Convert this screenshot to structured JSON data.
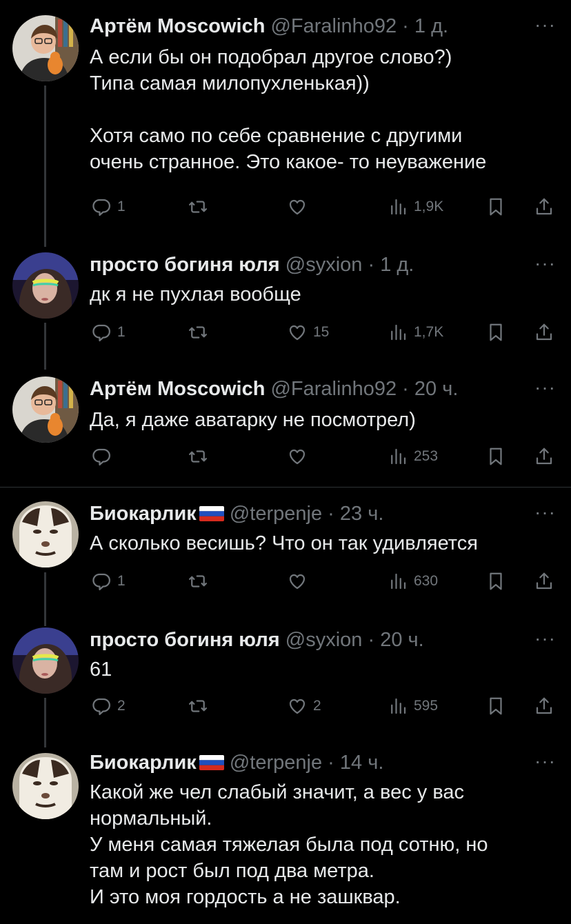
{
  "tweets": [
    {
      "name": "Артём Moscowich",
      "flag": false,
      "handle": "@Faralinho92",
      "dot": "·",
      "time": "1 д.",
      "more": "···",
      "text": "А если бы он подобрал другое слово?)\nТипа самая милопухленькая))\n\nХотя само по себе сравнение с другими\nочень странное. Это какое- то неуважение",
      "replies": "1",
      "retweets": "",
      "likes": "",
      "views": "1,9K",
      "avatar": "man"
    },
    {
      "name": "просто богиня юля",
      "flag": false,
      "handle": "@syxion",
      "dot": "·",
      "time": "1 д.",
      "more": "···",
      "text": "дк я не пухлая вообще",
      "replies": "1",
      "retweets": "",
      "likes": "15",
      "views": "1,7K",
      "avatar": "girl"
    },
    {
      "name": "Артём Moscowich",
      "flag": false,
      "handle": "@Faralinho92",
      "dot": "·",
      "time": "20 ч.",
      "more": "···",
      "text": "Да, я даже аватарку не посмотрел)",
      "replies": "",
      "retweets": "",
      "likes": "",
      "views": "253",
      "avatar": "man"
    },
    {
      "name": "Биокарлик",
      "flag": true,
      "handle": "@terpenje",
      "dot": "·",
      "time": "23 ч.",
      "more": "···",
      "text": "А сколько весишь? Что он так удивляется",
      "replies": "1",
      "retweets": "",
      "likes": "",
      "views": "630",
      "avatar": "cat"
    },
    {
      "name": "просто богиня юля",
      "flag": false,
      "handle": "@syxion",
      "dot": "·",
      "time": "20 ч.",
      "more": "···",
      "text": "61",
      "replies": "2",
      "retweets": "",
      "likes": "2",
      "views": "595",
      "avatar": "girl"
    },
    {
      "name": "Биокарлик",
      "flag": true,
      "handle": "@terpenje",
      "dot": "·",
      "time": "14 ч.",
      "more": "···",
      "text": "Какой же чел слабый значит, а вес у вас\nнормальный.\nУ меня самая тяжелая была под сотню, но\nтам и рост был под два метра.\nИ это моя гордость а не зашквар.",
      "replies": "",
      "retweets": "",
      "likes": "",
      "views": "",
      "avatar": "cat"
    }
  ],
  "icons": {
    "reply": "reply-icon",
    "retweet": "retweet-icon",
    "like": "heart-icon",
    "views": "views-icon",
    "bookmark": "bookmark-icon",
    "share": "share-icon"
  },
  "colors": {
    "background": "#000000",
    "text": "#e7e9ea",
    "muted": "#71767b",
    "divider": "#2f3336"
  }
}
